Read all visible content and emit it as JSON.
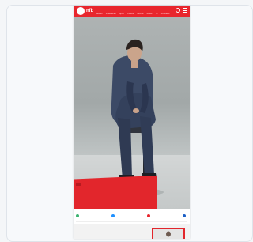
{
  "site": {
    "logo": "nfb",
    "nav_items": [
      "Nieuws",
      "Vlaanderen",
      "Sport",
      "Cultuur",
      "Muziek",
      "Radio",
      "TV",
      "Podcasts"
    ],
    "brand_color": "#e8262d"
  },
  "article": {
    "kicker": "",
    "headline": "",
    "byline": ""
  },
  "share": {
    "items": [
      {
        "label": "",
        "color": "#3cb371"
      },
      {
        "label": "",
        "color": "#1e90ff"
      },
      {
        "label": "",
        "color": "#e8262d"
      },
      {
        "label": "",
        "color": "#1b5fc6"
      }
    ]
  },
  "related": {
    "label": "",
    "title": ""
  }
}
